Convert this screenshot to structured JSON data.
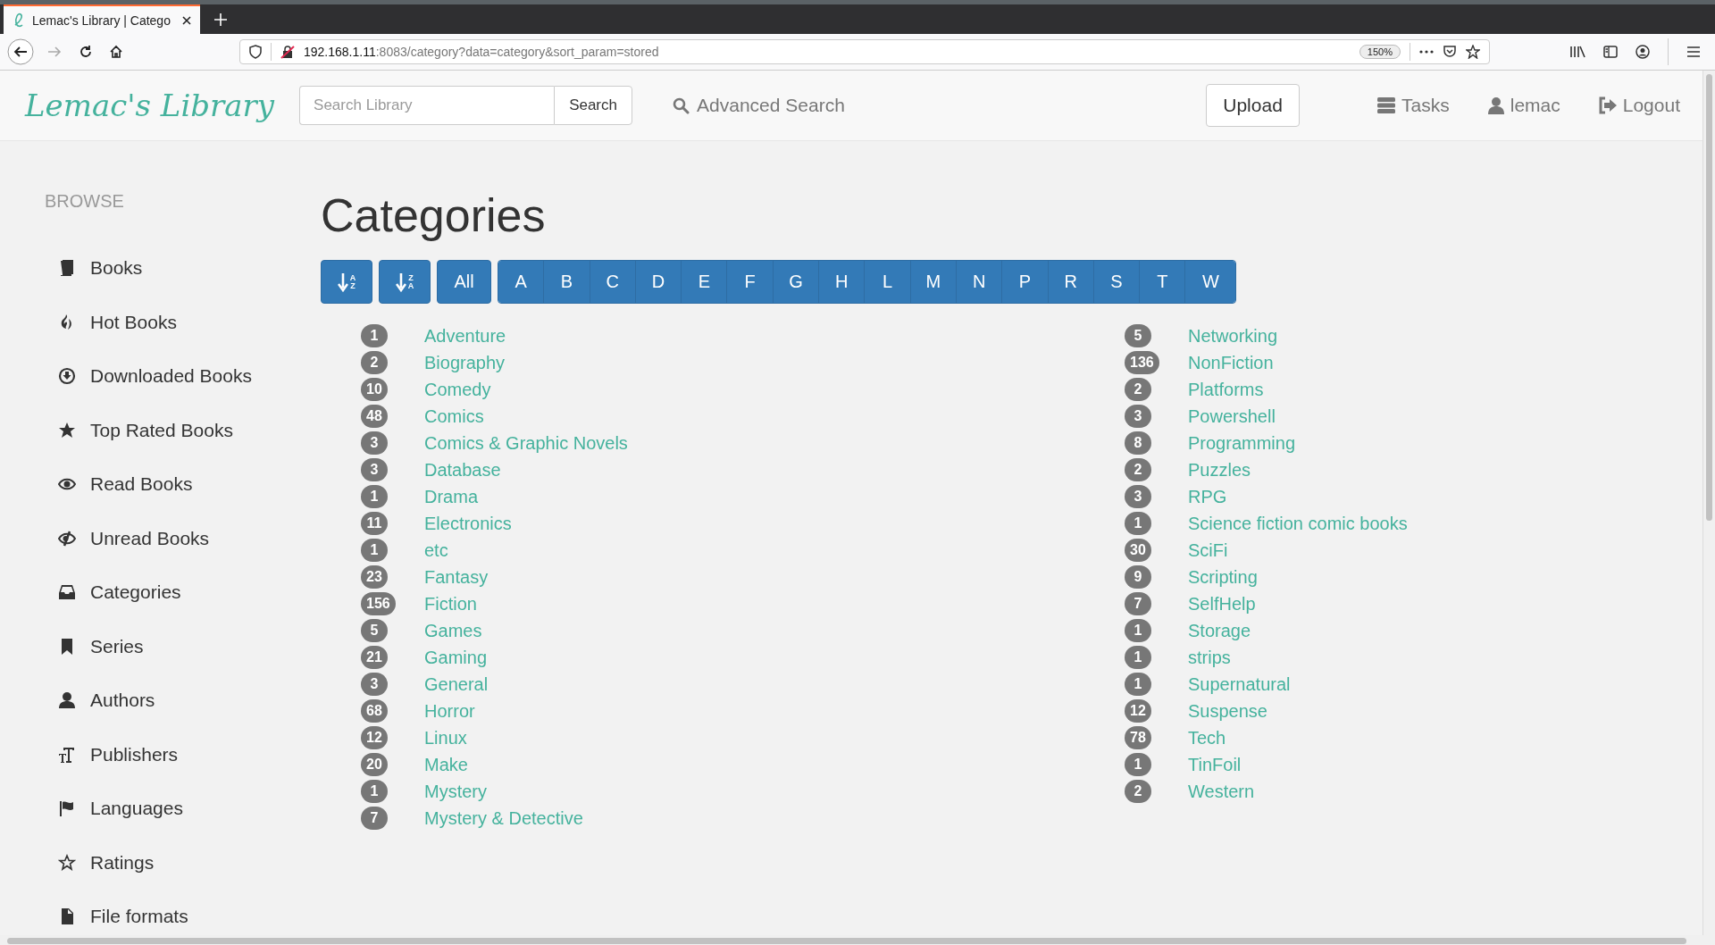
{
  "browser": {
    "tab_title": "Lemac's Library | Catego",
    "url_host": "192.168.1.11",
    "url_rest": ":8083/category?data=category&sort_param=stored",
    "zoom": "150%"
  },
  "header": {
    "logo": "Lemac's Library",
    "search_placeholder": "Search Library",
    "search_button": "Search",
    "advanced_search": "Advanced Search",
    "upload": "Upload",
    "nav": [
      "Tasks",
      "lemac",
      "Logout"
    ]
  },
  "sidebar": {
    "heading": "BROWSE",
    "items": [
      "Books",
      "Hot Books",
      "Downloaded Books",
      "Top Rated Books",
      "Read Books",
      "Unread Books",
      "Categories",
      "Series",
      "Authors",
      "Publishers",
      "Languages",
      "Ratings",
      "File formats"
    ]
  },
  "page_title": "Categories",
  "sort_buttons": [
    {
      "top": "A",
      "bottom": "Z"
    },
    {
      "top": "Z",
      "bottom": "A"
    }
  ],
  "all_button": "All",
  "letters": [
    "A",
    "B",
    "C",
    "D",
    "E",
    "F",
    "G",
    "H",
    "L",
    "M",
    "N",
    "P",
    "R",
    "S",
    "T",
    "W"
  ],
  "columns": [
    [
      {
        "count": "1",
        "name": "Adventure"
      },
      {
        "count": "2",
        "name": "Biography"
      },
      {
        "count": "10",
        "name": "Comedy"
      },
      {
        "count": "48",
        "name": "Comics"
      },
      {
        "count": "3",
        "name": "Comics & Graphic Novels"
      },
      {
        "count": "3",
        "name": "Database"
      },
      {
        "count": "1",
        "name": "Drama"
      },
      {
        "count": "11",
        "name": "Electronics"
      },
      {
        "count": "1",
        "name": "etc"
      },
      {
        "count": "23",
        "name": "Fantasy"
      },
      {
        "count": "156",
        "name": "Fiction"
      },
      {
        "count": "5",
        "name": "Games"
      },
      {
        "count": "21",
        "name": "Gaming"
      },
      {
        "count": "3",
        "name": "General"
      },
      {
        "count": "68",
        "name": "Horror"
      },
      {
        "count": "12",
        "name": "Linux"
      },
      {
        "count": "20",
        "name": "Make"
      },
      {
        "count": "1",
        "name": "Mystery"
      },
      {
        "count": "7",
        "name": "Mystery & Detective"
      }
    ],
    [
      {
        "count": "5",
        "name": "Networking"
      },
      {
        "count": "136",
        "name": "NonFiction"
      },
      {
        "count": "2",
        "name": "Platforms"
      },
      {
        "count": "3",
        "name": "Powershell"
      },
      {
        "count": "8",
        "name": "Programming"
      },
      {
        "count": "2",
        "name": "Puzzles"
      },
      {
        "count": "3",
        "name": "RPG"
      },
      {
        "count": "1",
        "name": "Science fiction comic books"
      },
      {
        "count": "30",
        "name": "SciFi"
      },
      {
        "count": "9",
        "name": "Scripting"
      },
      {
        "count": "7",
        "name": "SelfHelp"
      },
      {
        "count": "1",
        "name": "Storage"
      },
      {
        "count": "1",
        "name": "strips"
      },
      {
        "count": "1",
        "name": "Supernatural"
      },
      {
        "count": "12",
        "name": "Suspense"
      },
      {
        "count": "78",
        "name": "Tech"
      },
      {
        "count": "1",
        "name": "TinFoil"
      },
      {
        "count": "2",
        "name": "Western"
      }
    ]
  ]
}
